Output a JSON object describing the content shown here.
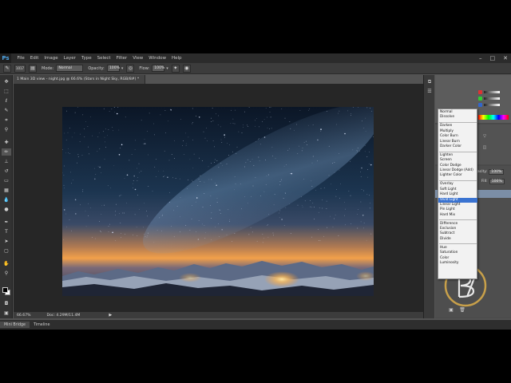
{
  "app": {
    "logo": "Ps",
    "menu": [
      "File",
      "Edit",
      "Image",
      "Layer",
      "Type",
      "Select",
      "Filter",
      "View",
      "Window",
      "Help"
    ],
    "window_controls": [
      "–",
      "□",
      "✕"
    ]
  },
  "options_bar": {
    "mode_label": "Mode:",
    "mode_value": "Normal",
    "opacity_label": "Opacity:",
    "opacity_value": "100%",
    "flow_label": "Flow:",
    "flow_value": "100%",
    "brush_size": "1017"
  },
  "document": {
    "tab_title": "1 Main 3D view - night.jpg @ 66.6% (Stars in Night Sky, RGB/8#) *",
    "zoom": "66.67%",
    "doc_size": "Doc: 4.29M/11.4M"
  },
  "bottom_tabs": [
    "Mini Bridge",
    "Timeline"
  ],
  "blend_modes": {
    "groups": [
      [
        "Normal",
        "Dissolve"
      ],
      [
        "Darken",
        "Multiply",
        "Color Burn",
        "Linear Burn",
        "Darker Color"
      ],
      [
        "Lighten",
        "Screen",
        "Color Dodge",
        "Linear Dodge (Add)",
        "Lighter Color"
      ],
      [
        "Overlay",
        "Soft Light",
        "Hard Light",
        "Vivid Light",
        "Linear Light",
        "Pin Light",
        "Hard Mix"
      ],
      [
        "Difference",
        "Exclusion",
        "Subtract",
        "Divide"
      ],
      [
        "Hue",
        "Saturation",
        "Color",
        "Luminosity"
      ]
    ],
    "selected": "Vivid Light"
  },
  "layers_panel": {
    "opacity_label": "pacity:",
    "opacity_value": "100%",
    "fill_label": "Fill:",
    "fill_value": "100%",
    "layers": [
      "ght Sky",
      "rightness/C...",
      "Layer 1"
    ]
  },
  "colors": {
    "chrome_dark": "#2b2b2b",
    "panel": "#535353",
    "canvas_bg": "#262626",
    "selection": "#3a73d1",
    "sky_top": "#0d1b2e",
    "horizon_glow": "#f2a04a"
  },
  "icons": [
    "move-icon",
    "marquee-icon",
    "lasso-icon",
    "quick-select-icon",
    "crop-icon",
    "eyedropper-icon",
    "healing-icon",
    "brush-icon",
    "stamp-icon",
    "history-brush-icon",
    "eraser-icon",
    "gradient-icon",
    "blur-icon",
    "dodge-icon",
    "pen-icon",
    "type-icon",
    "path-select-icon",
    "shape-icon",
    "hand-icon",
    "zoom-icon"
  ]
}
